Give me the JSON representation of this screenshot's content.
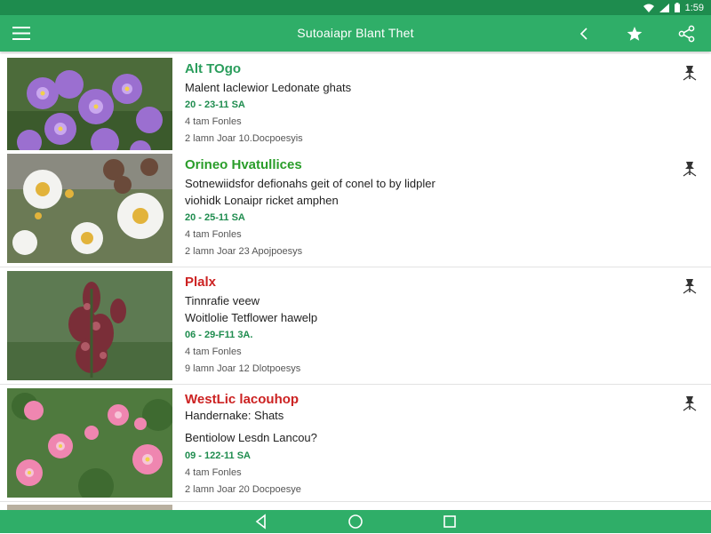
{
  "status_bar": {
    "time": "1:59"
  },
  "app_bar": {
    "title": "Sutoaiapr Blant Thet"
  },
  "entries": [
    {
      "name": "Alt TOgo",
      "name_color": "#2a9d5c",
      "line1": "Malent Iaclewior Ledonate ghats",
      "line2": "",
      "date": "20 - 23-11 SA",
      "meta1": "4 tam Fonles",
      "meta2": "2 lamn Joar 10.Docpoesyis"
    },
    {
      "name": "Orineo Hvatullices",
      "name_color": "#2a9d2a",
      "line1": "Sotnewiidsfor defionahs geit of conel to by lidpler",
      "line2": "viohidk Lonaipr ricket amphen",
      "date": "20 - 25-11 SA",
      "meta1": "4 tam Fonles",
      "meta2": "2 lamn Joar 23 Apojpoesys"
    },
    {
      "name": "Plalx",
      "name_color": "#cc2222",
      "line1": "Tinnrafie veew",
      "line2": "Woitlolie Tetflower hawelp",
      "date": "06 - 29-F11 3A.",
      "meta1": "4 tam Fonles",
      "meta2": "9 lamn Joar 12 Dlotpoesys"
    },
    {
      "name": "WestLic lacouhop",
      "name_color": "#cc2222",
      "line1": "Handernake: Shats",
      "line2": "Bentiolow Lesdn Lancou?",
      "date": "09 - 122-11 SA",
      "meta1": "4 tam Fonles",
      "meta2": "2 lamn Joar 20 Docpoesye"
    }
  ],
  "colors": {
    "status_bar": "#1e8c4e",
    "app_bar": "#2fae68",
    "accent_green": "#2a9d5c",
    "accent_red": "#cc2222"
  },
  "icons": {
    "app_bar": [
      "menu-icon",
      "back-arrow-icon",
      "star-icon",
      "share-icon"
    ],
    "row": "pin-icon",
    "nav": [
      "nav-back-icon",
      "nav-home-icon",
      "nav-recents-icon"
    ],
    "status": [
      "wifi-icon",
      "signal-icon",
      "battery-icon"
    ]
  }
}
